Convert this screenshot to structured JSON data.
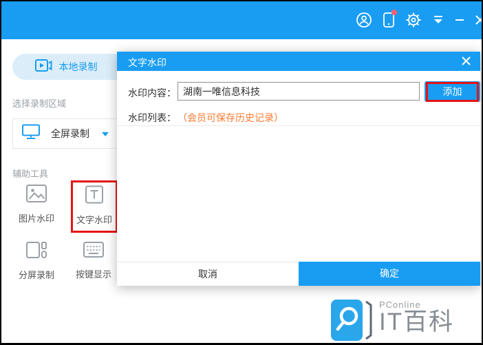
{
  "colors": {
    "accent_blue": "#189df2",
    "light_blue_pill": "#dcedfa",
    "note_orange": "#ff7a2f",
    "annotation_red": "#e51414",
    "badge_red": "#ff5f6b"
  },
  "titlebar": {
    "icons": [
      "user-icon",
      "phone-notification-icon",
      "settings-gear-icon",
      "collapse-arrow-icon",
      "minimize-icon",
      "close-icon"
    ]
  },
  "sidebar": {
    "local_record_tab": "本地录制",
    "region_section_label": "选择录制区域",
    "region_selected": "全屏录制",
    "tools_section_label": "辅助工具",
    "tools": [
      {
        "label": "图片水印",
        "icon": "image-watermark-icon",
        "highlighted": false
      },
      {
        "label": "文字水印",
        "icon": "text-watermark-icon",
        "highlighted": true
      },
      {
        "label": "分屏录制",
        "icon": "split-screen-icon",
        "highlighted": false
      },
      {
        "label": "按键显示",
        "icon": "keyboard-display-icon",
        "highlighted": false
      }
    ]
  },
  "dialog": {
    "title": "文字水印",
    "watermark_content_label": "水印内容：",
    "watermark_content_value": "湖南一唯信息科技",
    "add_button": "添加",
    "watermark_list_label": "水印列表：",
    "watermark_list_note": "（会员可保存历史记录）",
    "cancel_button": "取消",
    "confirm_button": "确定"
  },
  "footer_logo": {
    "brand": "PConline",
    "site": "IT百科"
  }
}
